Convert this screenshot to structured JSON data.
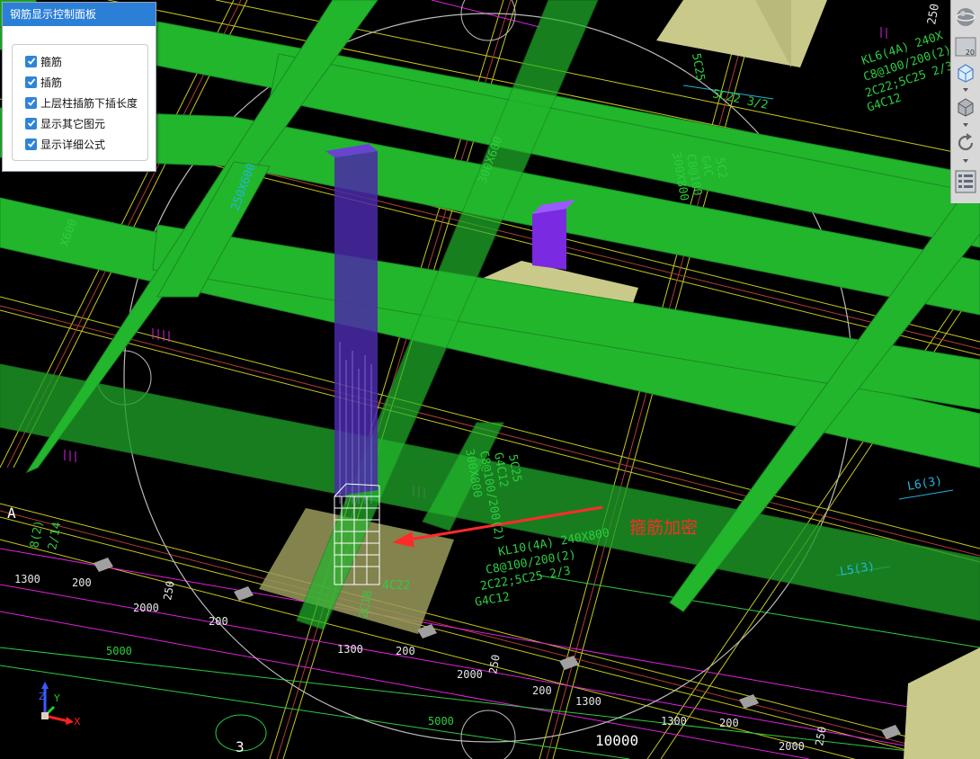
{
  "panel": {
    "title": "钢筋显示控制面板",
    "options": [
      {
        "label": "箍筋",
        "checked": true
      },
      {
        "label": "插筋",
        "checked": true
      },
      {
        "label": "上层柱插筋下插长度",
        "checked": true
      },
      {
        "label": "显示其它图元",
        "checked": true
      },
      {
        "label": "显示详细公式",
        "checked": true
      }
    ]
  },
  "toolbar": {
    "items": [
      "sphere-view-icon",
      "floor-20-icon",
      "wireframe-cube-icon",
      "solid-cube-icon",
      "rotate-icon",
      "layers-grid-icon"
    ],
    "floor_label": "20"
  },
  "annotation": {
    "label": "箍筋加密",
    "color": "#ff2b2b"
  },
  "axis": {
    "x": "X",
    "y": "Y",
    "z": "Z"
  },
  "drawing_labels": {
    "kl6_line1": "KL6(4A) 240X",
    "kl6_line2": "C8@100/200(2)",
    "kl6_line3": "2C22;5C25 2/3",
    "kl6_line4": "G4C12",
    "sc22": "5C22 3/2",
    "sc25": "5C25",
    "kl10_line1": "KL10(4A) 240X800",
    "kl10_line2": "C8@100/200(2)",
    "kl10_line3": "2C22;5C25 2/3",
    "kl10_line4": "G4C12",
    "col_label1": "300X800",
    "col_label2": "C8@100/200(2)",
    "col_label3": "G4C12",
    "col_label4": "5C25",
    "mid_label1": "300X800",
    "mid_label2": "C8@100",
    "mid_label3": "G4C",
    "mid_label4": "5C2",
    "x300": "300X600",
    "x600": "X600",
    "l6": "L6(3)",
    "l5": "L5(3)",
    "c4c22": "4C22",
    "c8": "2C18",
    "grid_a": "A",
    "grid_3": "3",
    "d1300a": "1300",
    "d200a": "200",
    "d250a": "250",
    "d2000a": "2000",
    "d200b": "200",
    "d1300b": "1300",
    "d200c": "200",
    "d250b": "250",
    "d2000b": "2000",
    "d200d": "200",
    "d1300c": "1300",
    "d1300d": "1300",
    "d200e": "200",
    "d250c": "250",
    "d2000c": "2000",
    "d5000a": "5000",
    "d5000b": "5000",
    "d10000": "10000",
    "top250": "250",
    "left_tag1": "8(2)",
    "left_tag2": "2/14",
    "left_tag3": "250X600"
  }
}
